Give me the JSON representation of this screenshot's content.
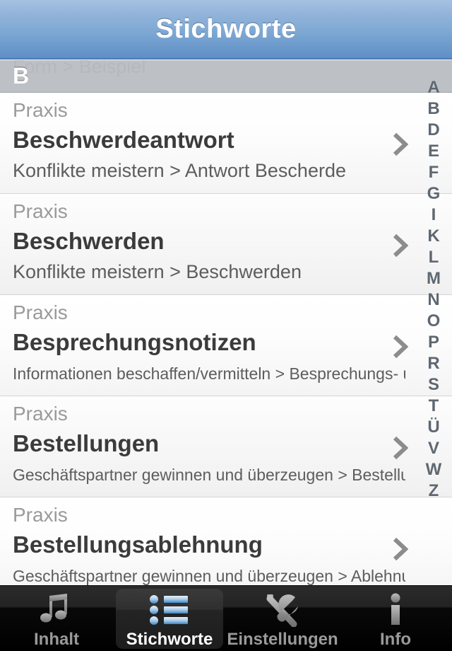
{
  "navbar": {
    "title": "Stichworte"
  },
  "list": {
    "ghost_row_text": "Form > Beispiel",
    "section_letter": "B",
    "category_label": "Praxis",
    "items": [
      {
        "category": "Praxis",
        "title": "Beschwerdeantwort",
        "path": "Konflikte meistern > Antwort Bescherde",
        "disclosure_icon": "chevron-right-icon"
      },
      {
        "category": "Praxis",
        "title": "Beschwerden",
        "path": "Konflikte meistern > Beschwerden",
        "disclosure_icon": "chevron-right-icon"
      },
      {
        "category": "Praxis",
        "title": "Besprechungsnotizen",
        "path": "Informationen beschaffen/vermitteln > Besprechungs- und Akt…",
        "disclosure_icon": "chevron-right-icon"
      },
      {
        "category": "Praxis",
        "title": "Bestellungen",
        "path": "Geschäftspartner gewinnen und überzeugen > Bestellungen/A…",
        "disclosure_icon": "chevron-right-icon"
      },
      {
        "category": "Praxis",
        "title": "Bestellungsablehnung",
        "path": "Geschäftspartner gewinnen und überzeugen > Ablehnung Bes…",
        "disclosure_icon": "chevron-right-icon"
      }
    ]
  },
  "index_bar": {
    "letters": [
      "A",
      "B",
      "D",
      "E",
      "F",
      "G",
      "I",
      "K",
      "L",
      "M",
      "N",
      "O",
      "P",
      "R",
      "S",
      "T",
      "Ü",
      "V",
      "W",
      "Z"
    ]
  },
  "tabbar": {
    "tabs": [
      {
        "label": "Inhalt",
        "icon": "music-note-icon",
        "active": false
      },
      {
        "label": "Stichworte",
        "icon": "bulleted-list-icon",
        "active": true
      },
      {
        "label": "Einstellungen",
        "icon": "tools-icon",
        "active": false
      },
      {
        "label": "Info",
        "icon": "info-icon",
        "active": false
      }
    ]
  },
  "colors": {
    "navbar_top": "#a6c2e2",
    "navbar_bottom": "#5f8ec6",
    "title_text": "#ffffff",
    "row_title_text": "#3b3b3b",
    "row_category_text": "#9a9a9a",
    "row_path_text": "#5d5d5d",
    "section_header_bg": "#b2b7bc",
    "index_letter": "#5f6771",
    "tabbar_bg": "#000000",
    "tab_active_label": "#ffffff",
    "tab_inactive_label": "#9a9a9a",
    "tab_active_icon": "#4a90d9"
  }
}
